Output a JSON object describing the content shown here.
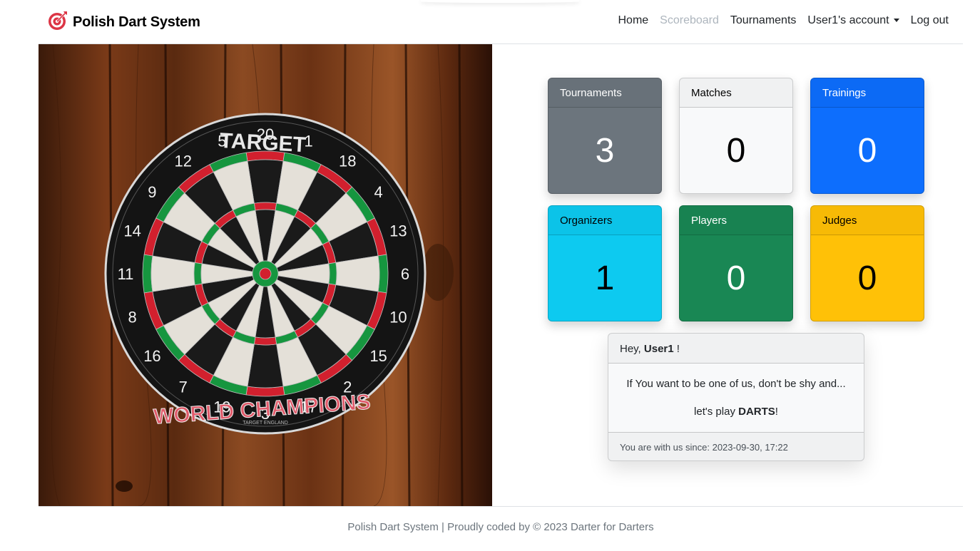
{
  "brand": {
    "name": "Polish Dart System",
    "icon": "bullseye-icon",
    "icon_color": "#dc3545"
  },
  "nav": {
    "home": "Home",
    "scoreboard": "Scoreboard",
    "tournaments": "Tournaments",
    "account": "User1's account",
    "logout": "Log out"
  },
  "hero": {
    "image": "dartboard-photo",
    "board_texts": {
      "brand": "TARGET",
      "slogan": "WORLD CHAMPIONS",
      "maker": "TARGET ENGLAND"
    },
    "numbers": [
      "20",
      "1",
      "18",
      "4",
      "13",
      "6",
      "10",
      "15",
      "2",
      "17",
      "3",
      "19",
      "7",
      "16",
      "8",
      "11",
      "14",
      "9",
      "12",
      "5"
    ]
  },
  "stats": {
    "tournaments": {
      "label": "Tournaments",
      "value": "3",
      "color": "#6c757d"
    },
    "matches": {
      "label": "Matches",
      "value": "0",
      "color": "#f8f9fa"
    },
    "trainings": {
      "label": "Trainings",
      "value": "0",
      "color": "#0d6efd"
    },
    "organizers": {
      "label": "Organizers",
      "value": "1",
      "color": "#0dcaf0"
    },
    "players": {
      "label": "Players",
      "value": "0",
      "color": "#198754"
    },
    "judges": {
      "label": "Judges",
      "value": "0",
      "color": "#ffc107"
    }
  },
  "welcome": {
    "greeting": "Hey,",
    "username": "User1",
    "greeting_end": "!",
    "line1": "If You want to be one of us, don't be shy and...",
    "line2_prefix": "let's play",
    "line2_bold": "DARTS",
    "line2_suffix": "!",
    "since": "You are with us since: 2023-09-30, 17:22"
  },
  "footer": {
    "text": "Polish Dart System | Proudly coded by © 2023 Darter for Darters"
  }
}
